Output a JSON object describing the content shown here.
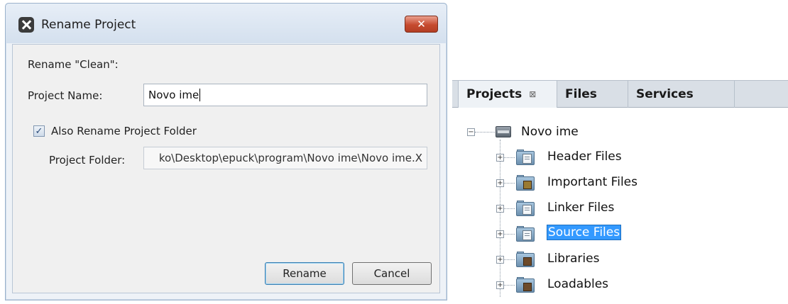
{
  "dialog": {
    "title": "Rename Project",
    "close_label": "✕",
    "rename_prompt": "Rename \"Clean\":",
    "project_name_label": "Project Name:",
    "project_name_value": "Novo ime",
    "also_rename_label": "Also Rename Project Folder",
    "also_rename_checked": true,
    "project_folder_label": "Project Folder:",
    "project_folder_value": "ko\\Desktop\\epuck\\program\\Novo ime\\Novo ime.X",
    "rename_button": "Rename",
    "cancel_button": "Cancel"
  },
  "projects_panel": {
    "tabs": [
      {
        "label": "Projects",
        "active": true,
        "close": "⊠"
      },
      {
        "label": "Files",
        "active": false
      },
      {
        "label": "Services",
        "active": false
      }
    ],
    "root": {
      "label": "Novo ime",
      "expanded": true,
      "icon": "project-chip-icon"
    },
    "children": [
      {
        "label": "Header Files",
        "icon": "folder-document-icon",
        "selected": false
      },
      {
        "label": "Important Files",
        "icon": "folder-important-icon",
        "selected": false
      },
      {
        "label": "Linker Files",
        "icon": "folder-document-icon",
        "selected": false
      },
      {
        "label": "Source Files",
        "icon": "folder-document-icon",
        "selected": true
      },
      {
        "label": "Libraries",
        "icon": "folder-library-icon",
        "selected": false
      },
      {
        "label": "Loadables",
        "icon": "folder-library-icon",
        "selected": false
      }
    ],
    "colors": {
      "selection": "#3399ff"
    }
  }
}
